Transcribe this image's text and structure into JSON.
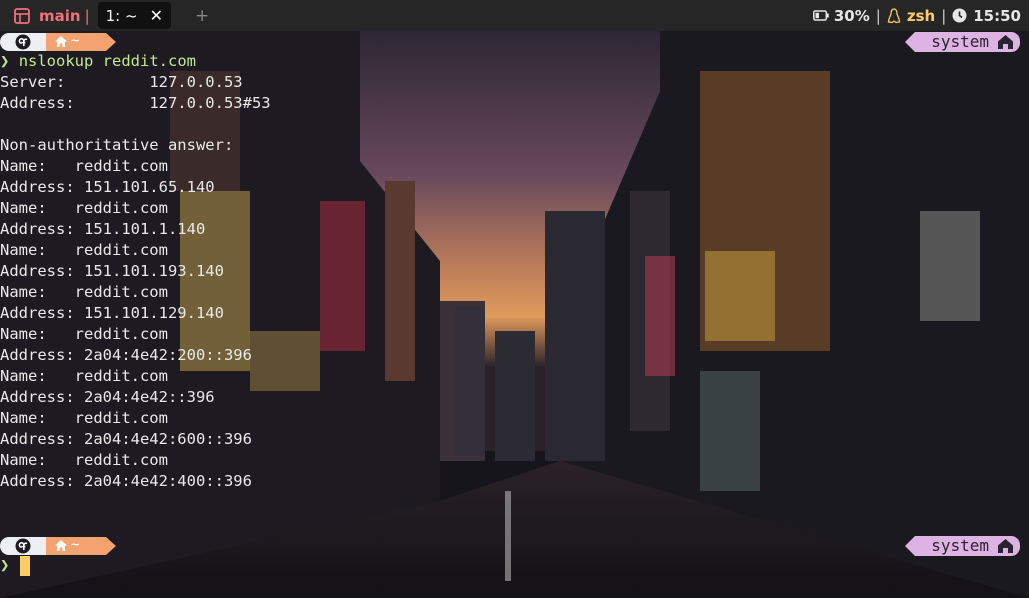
{
  "topbar": {
    "session_name": "main",
    "session_separator": "|",
    "tabs": [
      {
        "label": "1: ~",
        "close_label": "✕",
        "active": true
      }
    ],
    "new_tab_label": "+",
    "battery": "30%",
    "shell": "zsh",
    "time": "15:50",
    "separator": "|",
    "accent_color": "#f07178"
  },
  "prompt": {
    "home_label": "~",
    "context_label": "system",
    "chevron": "❯",
    "os_icon": "fedora-icon",
    "home_icon": "house-icon"
  },
  "terminal": {
    "command": "nslookup reddit.com",
    "lines": [
      "Server:\t\t127.0.0.53",
      "Address:\t127.0.0.53#53",
      "",
      "Non-authoritative answer:",
      "Name:\treddit.com",
      "Address: 151.101.65.140",
      "Name:\treddit.com",
      "Address: 151.101.1.140",
      "Name:\treddit.com",
      "Address: 151.101.193.140",
      "Name:\treddit.com",
      "Address: 151.101.129.140",
      "Name:\treddit.com",
      "Address: 2a04:4e42:200::396",
      "Name:\treddit.com",
      "Address: 2a04:4e42::396",
      "Name:\treddit.com",
      "Address: 2a04:4e42:600::396",
      "Name:\treddit.com",
      "Address: 2a04:4e42:400::396"
    ]
  }
}
